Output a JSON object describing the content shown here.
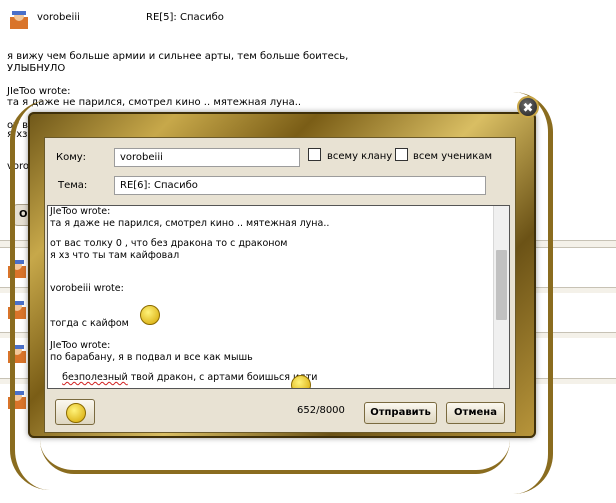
{
  "background_post": {
    "author": "vorobeiii",
    "subject": "RE[5]: Спасибо",
    "text": "я вижу чем больше армии и сильнее арты, тем больше боитесь,\nУЛЫБНУЛО\n\nJIeToo wrote:\nта я даже не парился, смотрел кино .. мятежная луна..\n\nот в",
    "partial_line_2": "я хз",
    "partial_line_3": "voro",
    "button_label": "О"
  },
  "dialog": {
    "to_label": "Кому:",
    "to_value": "vorobeiii",
    "clan_label": "всему клану",
    "students_label": "всем ученикам",
    "subject_label": "Тема:",
    "subject_value": "RE[6]: Спасибо",
    "message_lines": {
      "l1": "JIeToo wrote:",
      "l2": "та я даже не парился, смотрел кино .. мятежная луна..",
      "l3": "от вас толку 0 , что без дракона то с драконом",
      "l4": "я хз что ты там кайфовал",
      "l5": "vorobeiii wrote:",
      "l6": "тогда с кайфом",
      "l7": "JIeToo wrote:",
      "l8": "по барабану, я в подвал и все как мышь",
      "l9a": "безполезный",
      "l9b": " твой дракон, с артами боишься идти"
    },
    "counter": "652/8000",
    "send_label": "Отправить",
    "cancel_label": "Отмена",
    "close_label": "✖"
  },
  "colors": {
    "frame_gold": "#c7a84a",
    "panel": "#e8e2d3"
  },
  "icons": [
    "avatar-icon",
    "smiley-icon",
    "close-icon"
  ]
}
